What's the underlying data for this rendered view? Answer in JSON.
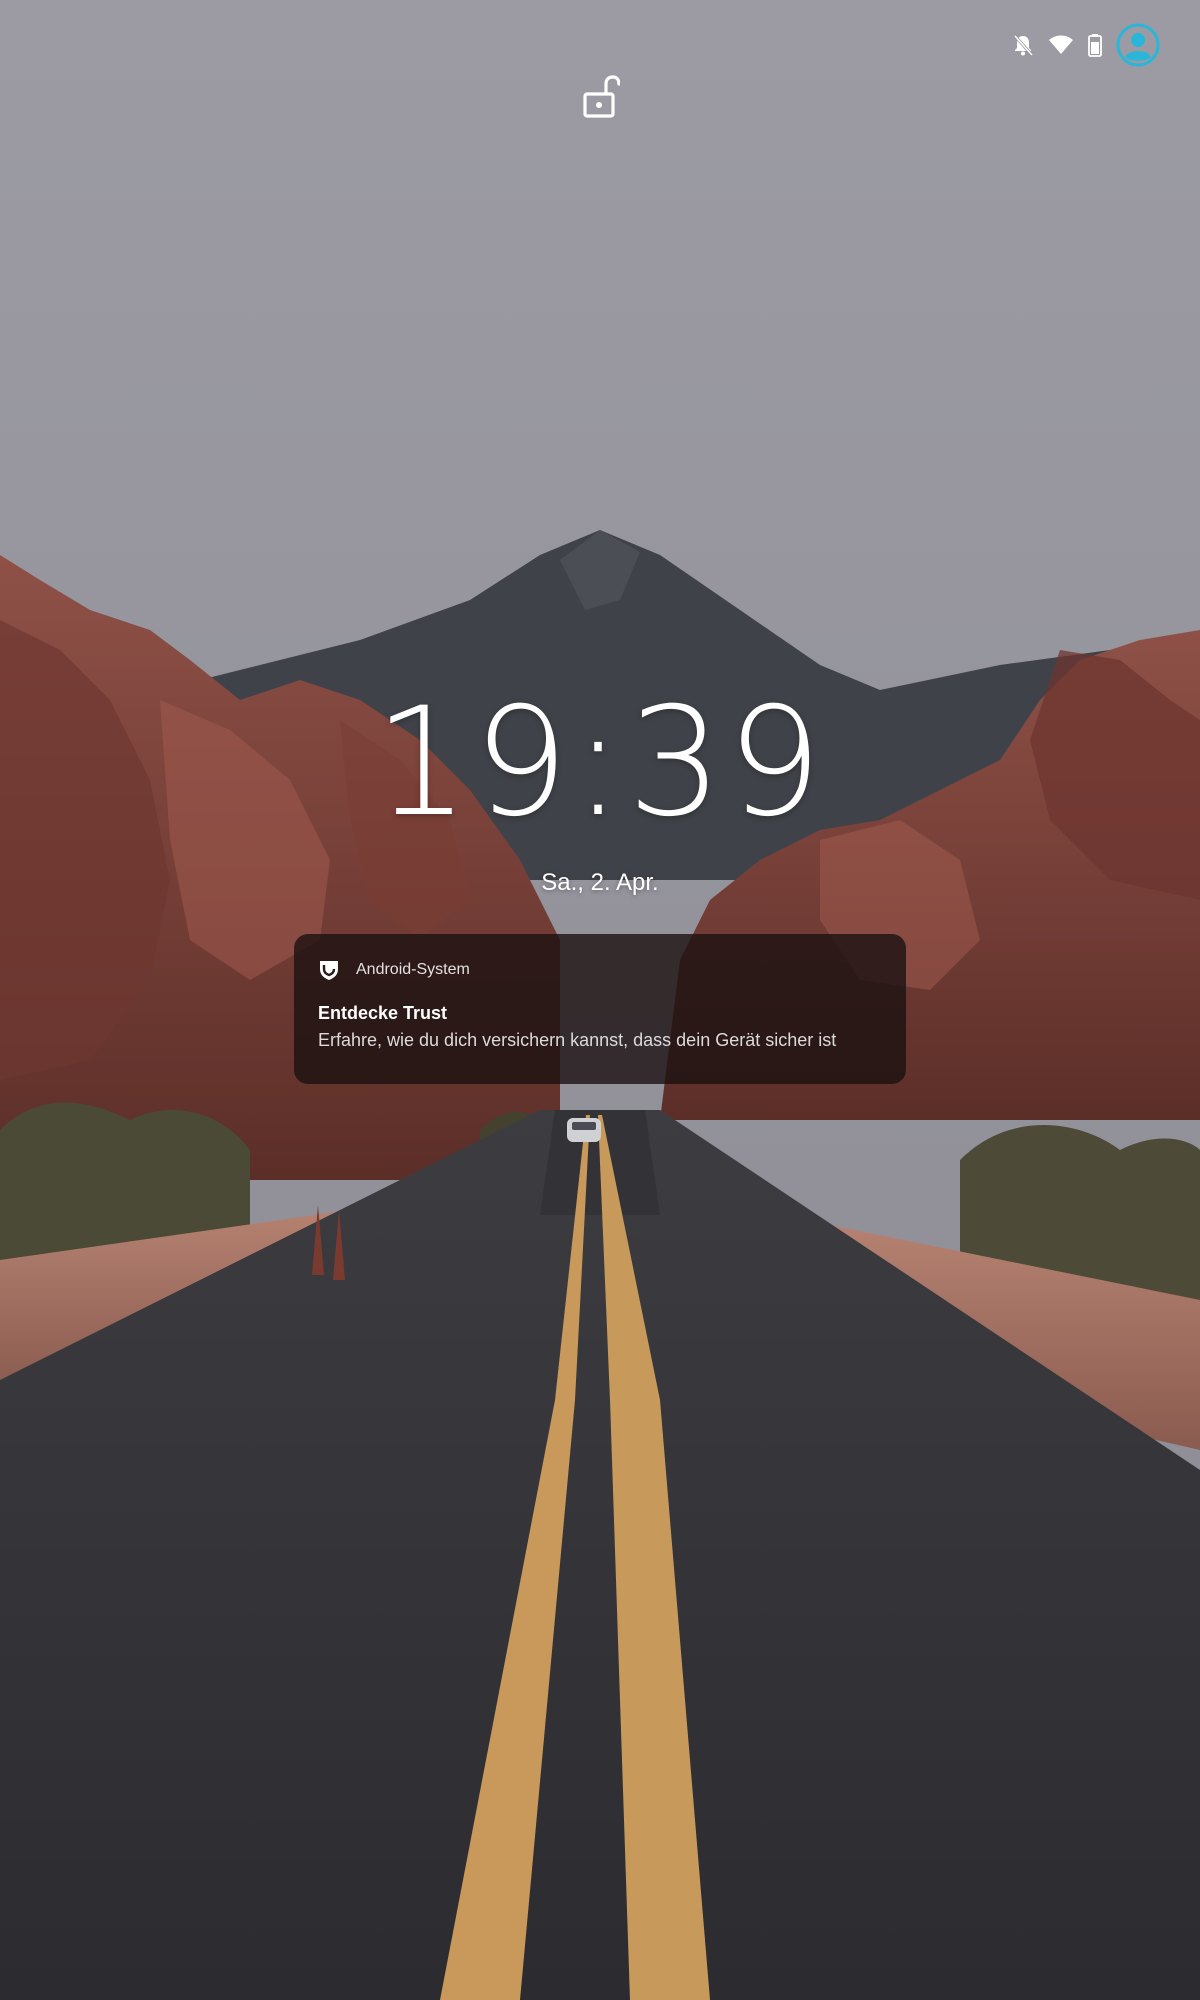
{
  "status_bar": {
    "icons": [
      "notifications-off-icon",
      "wifi-icon",
      "battery-icon",
      "user-avatar-icon"
    ],
    "accent_color": "#29b6d9"
  },
  "lock_screen": {
    "lock_icon": "unlocked-padlock-icon",
    "time": "19:39",
    "date": "Sa., 2. Apr."
  },
  "notification": {
    "app_icon": "android-system-icon",
    "app_name": "Android-System",
    "title": "Entdecke Trust",
    "text": "Erfahre, wie du dich versichern kannst, dass dein Gerät sicher ist"
  }
}
